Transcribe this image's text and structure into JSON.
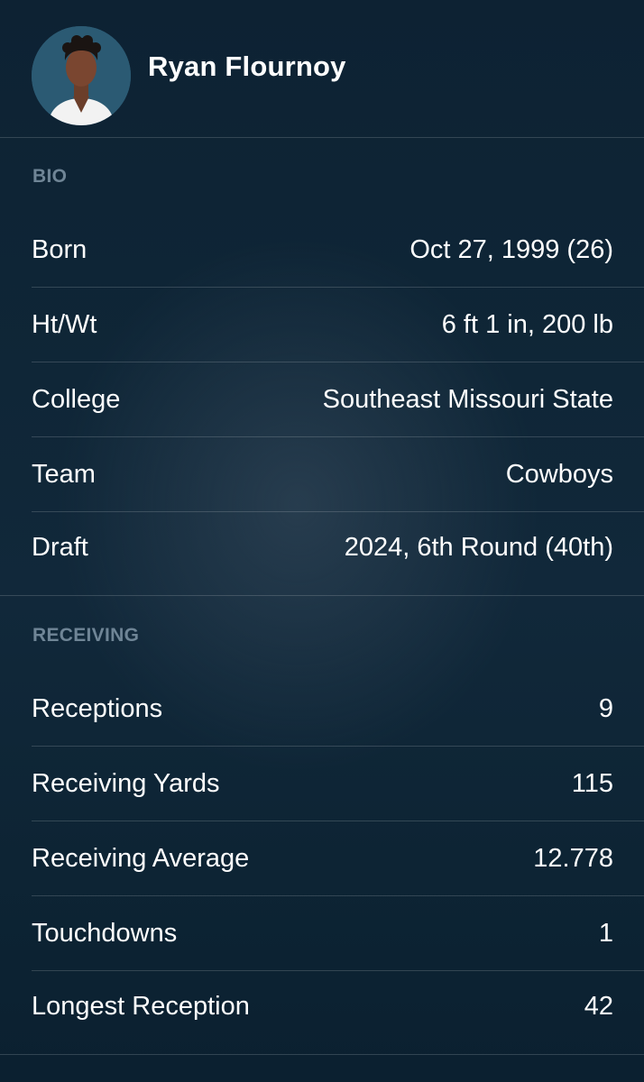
{
  "player": {
    "name": "Ryan Flournoy"
  },
  "bio": {
    "section_label": "BIO",
    "rows": [
      {
        "label": "Born",
        "value": "Oct 27, 1999 (26)"
      },
      {
        "label": "Ht/Wt",
        "value": "6 ft 1 in, 200 lb"
      },
      {
        "label": "College",
        "value": "Southeast Missouri State"
      },
      {
        "label": "Team",
        "value": "Cowboys"
      },
      {
        "label": "Draft",
        "value": "2024, 6th Round (40th)"
      }
    ]
  },
  "receiving": {
    "section_label": "RECEIVING",
    "rows": [
      {
        "label": "Receptions",
        "value": "9"
      },
      {
        "label": "Receiving Yards",
        "value": "115"
      },
      {
        "label": "Receiving Average",
        "value": "12.778"
      },
      {
        "label": "Touchdowns",
        "value": "1"
      },
      {
        "label": "Longest Reception",
        "value": "42"
      }
    ]
  },
  "colors": {
    "background": "#0f2637",
    "section_label": "#6f8596",
    "text": "#ffffff",
    "avatar_bg": "#2b5a73"
  }
}
